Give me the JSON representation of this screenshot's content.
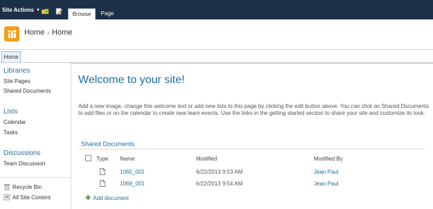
{
  "ribbon": {
    "site_actions": "Site Actions",
    "tabs": [
      {
        "label": "Browse",
        "active": true
      },
      {
        "label": "Page",
        "active": false
      }
    ]
  },
  "header": {
    "breadcrumb": [
      "Home",
      "Home"
    ],
    "breadcrumb_sep": "›"
  },
  "topnav": {
    "home_tab": "Home"
  },
  "leftnav": {
    "sections": [
      {
        "heading": "Libraries",
        "items": [
          "Site Pages",
          "Shared Documents"
        ]
      },
      {
        "heading": "Lists",
        "items": [
          "Calendar",
          "Tasks"
        ]
      },
      {
        "heading": "Discussions",
        "items": [
          "Team Discussion"
        ]
      }
    ],
    "utilities": [
      "Recycle Bin",
      "All Site Content"
    ]
  },
  "main": {
    "title": "Welcome to your site!",
    "description": "Add a new image, change this welcome text or add new lists to this page by clicking the edit button above. You can click on Shared Documents to add files or on the calendar to create new team events. Use the links in the getting started section to share your site and customize its look.",
    "webpart": {
      "title": "Shared Documents",
      "columns": [
        "Type",
        "Name",
        "Modified",
        "Modified By"
      ],
      "rows": [
        {
          "name": "1065_001",
          "modified": "6/22/2013 9:53 AM",
          "modified_by": "Jean Paul"
        },
        {
          "name": "1069_001",
          "modified": "6/22/2013 9:54 AM",
          "modified_by": "Jean Paul"
        }
      ],
      "add_label": "Add document"
    }
  },
  "colors": {
    "ribbon": "#1c3048",
    "link": "#1a6ea5",
    "heading": "#2b6ea0",
    "add_plus": "#3a9a2f"
  }
}
